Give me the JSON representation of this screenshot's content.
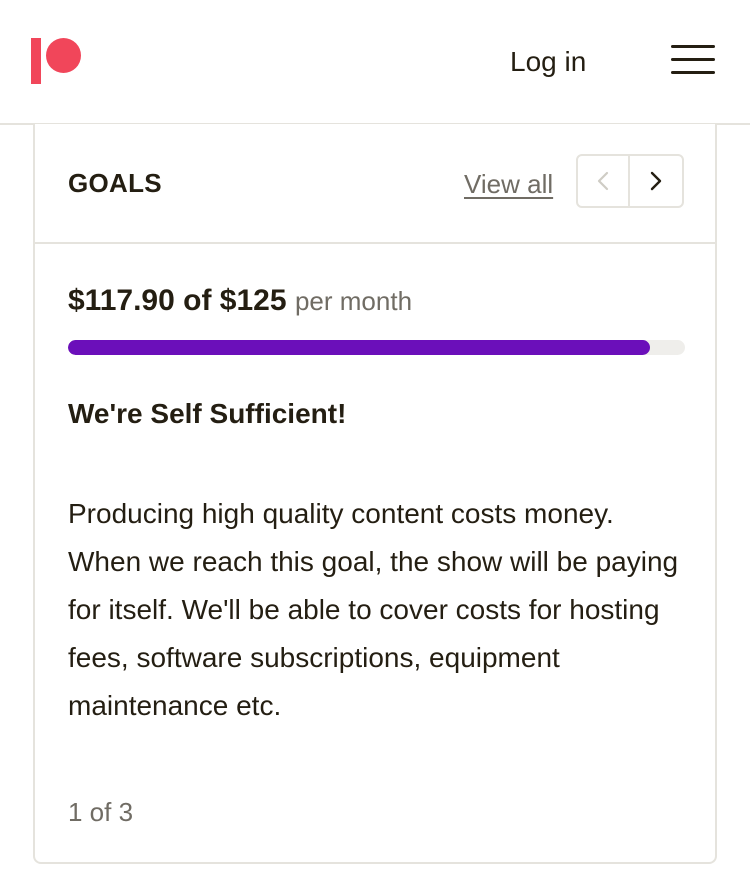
{
  "header": {
    "login_label": "Log in",
    "logo_icon": "patreon-logo-icon",
    "menu_icon": "hamburger-menu-icon",
    "brand_color": "#f1465a"
  },
  "goals": {
    "title": "GOALS",
    "view_all_label": "View all",
    "prev_icon": "chevron-left-icon",
    "next_icon": "chevron-right-icon",
    "amount": "$117.90 of $125",
    "period": "per month",
    "progress_fraction": 0.9432,
    "progress_color": "#6b0fba",
    "goal_title": "We're Self Sufficient!",
    "goal_description": "Producing high quality content costs money. When we reach this goal, the show will be paying for itself. We'll be able to cover costs for hosting fees, software subscriptions, equipment maintenance etc.",
    "page_indicator": "1 of 3"
  }
}
